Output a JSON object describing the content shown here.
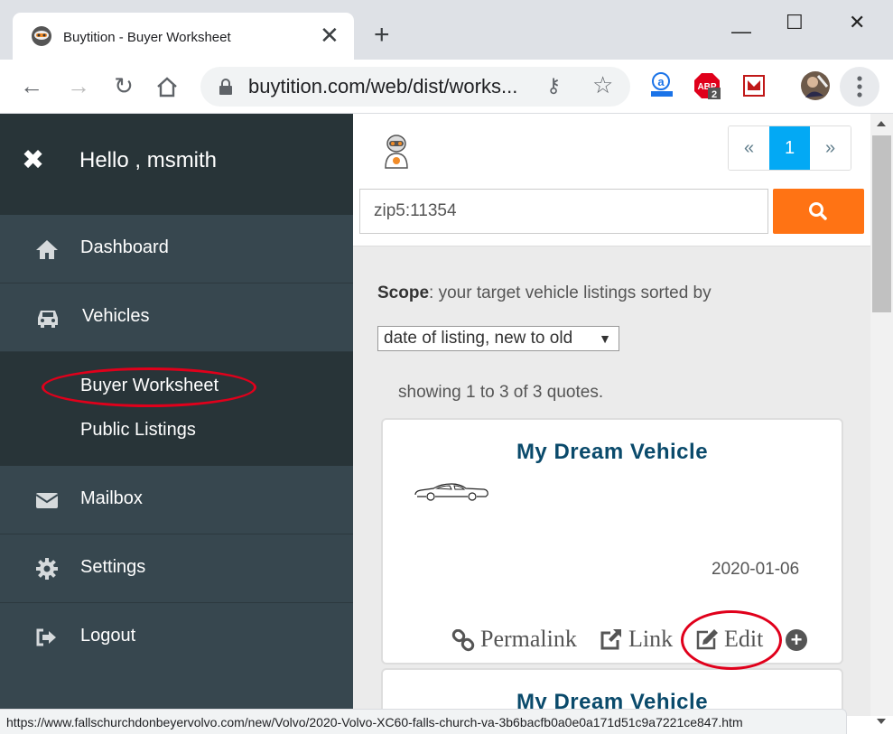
{
  "browser": {
    "tab_title": "Buytition - Buyer Worksheet",
    "url": "buytition.com/web/dist/works...",
    "extension_badge": "2",
    "status_url": "https://www.fallschurchdonbeyervolvo.com/new/Volvo/2020-Volvo-XC60-falls-church-va-3b6bacfb0a0e0a171d51c9a7221ce847.htm"
  },
  "sidebar": {
    "greeting": "Hello , msmith",
    "items": [
      {
        "label": "Dashboard",
        "icon": "home-icon"
      },
      {
        "label": "Vehicles",
        "icon": "car-icon"
      },
      {
        "label": "Mailbox",
        "icon": "envelope-icon"
      },
      {
        "label": "Settings",
        "icon": "gear-icon"
      },
      {
        "label": "Logout",
        "icon": "sign-out-icon"
      }
    ],
    "submenu": [
      {
        "label": "Buyer Worksheet"
      },
      {
        "label": "Public Listings"
      }
    ]
  },
  "pager": {
    "prev": "«",
    "current": "1",
    "next": "»"
  },
  "search": {
    "value": "zip5:11354"
  },
  "scope": {
    "label": "Scope",
    "text": ": your target vehicle listings sorted by",
    "sort_selected": "date of listing, new to old",
    "showing": "showing 1 to 3 of 3 quotes."
  },
  "cards": [
    {
      "title": "My Dream Vehicle",
      "date": "2020-01-06",
      "actions": {
        "permalink": "Permalink",
        "link": "Link",
        "edit": "Edit"
      }
    },
    {
      "title": "My Dream Vehicle"
    }
  ],
  "colors": {
    "sidebar": "#37474f",
    "accent_orange": "#ff7314",
    "pager_active": "#03a9f4",
    "title_blue": "#0a4a6b",
    "annotation_red": "#e0001b"
  }
}
